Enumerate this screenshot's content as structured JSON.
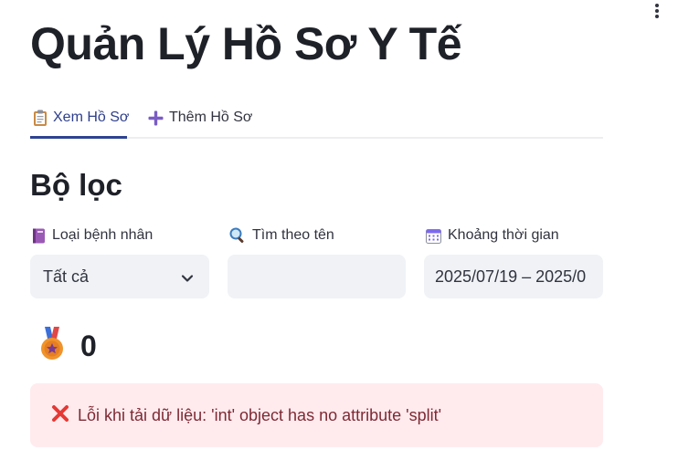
{
  "app": {
    "title": "Quản Lý Hồ Sơ Y Tế"
  },
  "header": {
    "menu_icon": "vertical-ellipsis-icon"
  },
  "tabs": [
    {
      "label": "Xem Hồ Sơ",
      "icon": "clipboard-icon",
      "active": true
    },
    {
      "label": "Thêm Hồ Sơ",
      "icon": "plus-icon",
      "active": false
    }
  ],
  "filters": {
    "title": "Bộ lọc",
    "patient_type": {
      "label": "Loại bệnh nhân",
      "icon": "ledger-icon",
      "value": "Tất cả"
    },
    "search": {
      "label": "Tìm theo tên",
      "icon": "magnifier-icon",
      "value": ""
    },
    "date_range": {
      "label": "Khoảng thời gian",
      "icon": "calendar-icon",
      "value": "2025/07/19 – 2025/0"
    }
  },
  "metric": {
    "icon": "medal-icon",
    "value": "0"
  },
  "error": {
    "icon": "cross-mark-icon",
    "message": "Lỗi khi tải dữ liệu: 'int' object has no attribute 'split'"
  },
  "colors": {
    "active_tab": "#2e3f8b",
    "input_bg": "#f0f2f6",
    "error_bg": "#ffebee",
    "error_text": "#7d2a34"
  }
}
